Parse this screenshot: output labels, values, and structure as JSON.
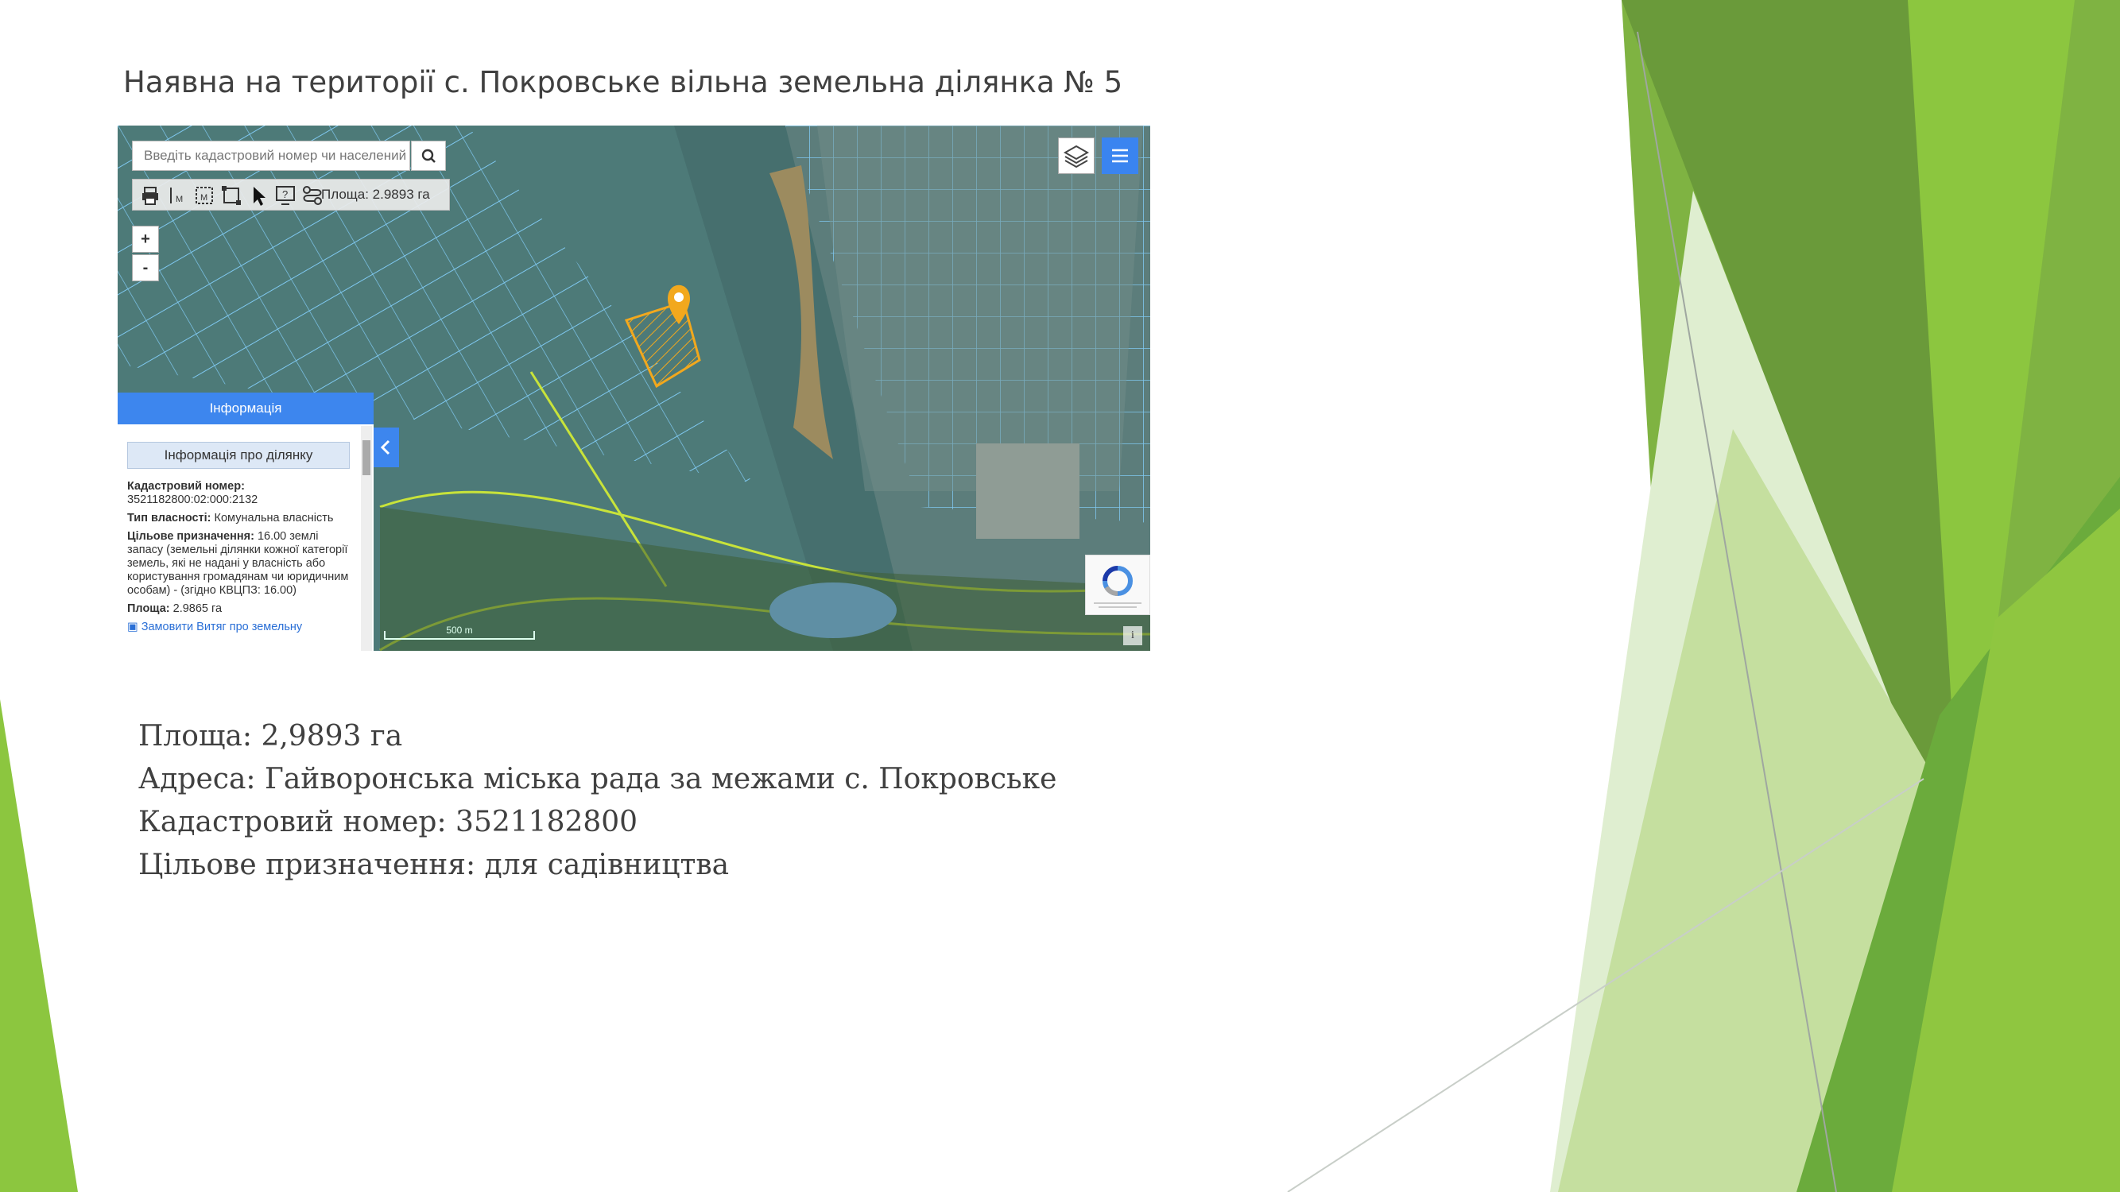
{
  "slide": {
    "title": "Наявна на території с. Покровське вільна земельна ділянка № 5",
    "details": [
      "Площа: 2,9893 га",
      "Адреса: Гайворонська міська рада за межами с. Покровське",
      "Кадастровий номер: 3521182800",
      "Цільове призначення: для садівництва"
    ]
  },
  "map": {
    "search_placeholder": "Введіть кадастровий номер чи населений пун",
    "tools": [
      "printer-icon",
      "measure-line-icon",
      "measure-area-icon",
      "select-area-icon",
      "pointer-icon",
      "help-icon",
      "route-icon"
    ],
    "area_readout": "Площа: 2.9893 га",
    "zoom_in": "+",
    "zoom_out": "-",
    "info_tab": "Інформація",
    "info_header": "Інформація про ділянку",
    "parcel": {
      "cadastral_label": "Кадастровий номер:",
      "cadastral_value": "3521182800:02:000:2132",
      "ownership_label": "Тип власності:",
      "ownership_value": "Комунальна власність",
      "purpose_label": "Цільове призначення:",
      "purpose_value": "16.00 землі запасу (земельні ділянки кожної категорії земель, які не надані у власність або користування громадянам чи юридичним особам) - (згідно КВЦПЗ: 16.00)",
      "area_label": "Площа:",
      "area_value": "2.9865 га",
      "more_link": "Замовити Витяг про земельну"
    },
    "scale_label": "500 m",
    "corner_info": "i",
    "colors": {
      "accent": "#3d86ee",
      "parcel_lines": "#7fc8f0",
      "boundary": "#c8e33a",
      "marker": "#f2a81d"
    }
  }
}
